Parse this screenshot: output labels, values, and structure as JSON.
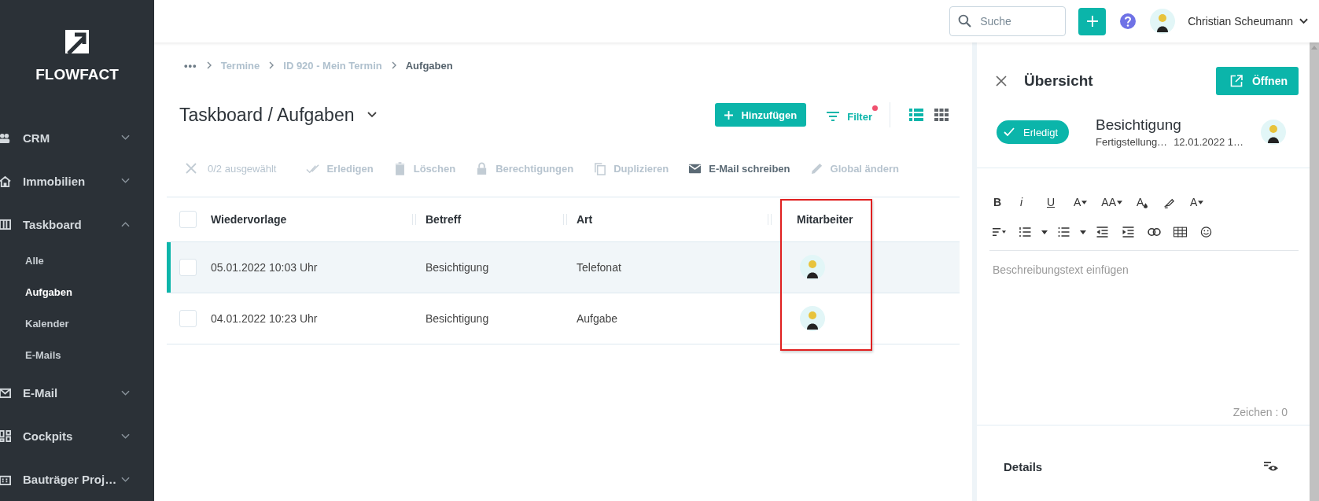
{
  "sidebar": {
    "logo": "FLOWFACT",
    "items": [
      {
        "label": "CRM",
        "expanded": false
      },
      {
        "label": "Immobilien",
        "expanded": false
      },
      {
        "label": "Taskboard",
        "expanded": true,
        "children": [
          {
            "label": "Alle",
            "selected": false
          },
          {
            "label": "Aufgaben",
            "selected": true
          },
          {
            "label": "Kalender",
            "selected": false
          },
          {
            "label": "E-Mails",
            "selected": false
          }
        ]
      },
      {
        "label": "E-Mail",
        "expanded": false
      },
      {
        "label": "Cockpits",
        "expanded": false
      },
      {
        "label": "Bauträger Proj…",
        "expanded": false
      }
    ]
  },
  "topbar": {
    "search": {
      "placeholder": "Suche"
    },
    "user": {
      "name": "Christian Scheumann"
    }
  },
  "breadcrumbs": [
    {
      "label": "•••",
      "current": false
    },
    {
      "label": "Termine",
      "current": false
    },
    {
      "label": "ID 920 - Mein Termin",
      "current": false
    },
    {
      "label": "Aufgaben",
      "current": true
    }
  ],
  "page": {
    "title": "Taskboard / Aufgaben",
    "add_button": "Hinzufügen",
    "filter": {
      "label": "Filter",
      "active": true
    },
    "views": [
      {
        "selected": true
      },
      {
        "selected": false
      }
    ]
  },
  "bulk_actions": {
    "selection": "0/2 ausgewählt",
    "actions": [
      {
        "label": "Erledigen",
        "disabled": true
      },
      {
        "label": "Löschen",
        "disabled": true
      },
      {
        "label": "Berechtigungen",
        "disabled": true
      },
      {
        "label": "Duplizieren",
        "disabled": true
      },
      {
        "label": "E-Mail schreiben",
        "disabled": false
      },
      {
        "label": "Global ändern",
        "disabled": true
      }
    ]
  },
  "table": {
    "columns": [
      "Wiedervorlage",
      "Betreff",
      "Art",
      "Mitarbeiter"
    ],
    "header_checked": false,
    "rows": [
      {
        "selected": true,
        "checked": false,
        "cells": [
          "05.01.2022 10:03 Uhr",
          "Besichtigung",
          "Telefonat"
        ]
      },
      {
        "selected": false,
        "checked": false,
        "cells": [
          "04.01.2022 10:23 Uhr",
          "Besichtigung",
          "Aufgabe"
        ]
      }
    ]
  },
  "panel": {
    "title": "Übersicht",
    "open_button": "Öffnen",
    "status": {
      "label": "Erledigt",
      "done": true
    },
    "subject": "Besichtigung",
    "meta_label": "Fertigstellung…",
    "meta_value": "12.01.2022 1…",
    "editor": {
      "format_buttons": [
        {
          "kind": "bold",
          "label": "B"
        },
        {
          "kind": "italic",
          "label": "i"
        },
        {
          "kind": "underline",
          "label": "U"
        },
        {
          "kind": "dropdown",
          "label": "A"
        },
        {
          "kind": "dropdown",
          "label": "AA"
        },
        {
          "kind": "color",
          "label": "A"
        },
        {
          "kind": "highlighter"
        },
        {
          "kind": "style",
          "label": "A"
        }
      ],
      "placeholder": "Beschreibungstext einfügen",
      "counter": "Zeichen : 0"
    },
    "details_title": "Details"
  }
}
